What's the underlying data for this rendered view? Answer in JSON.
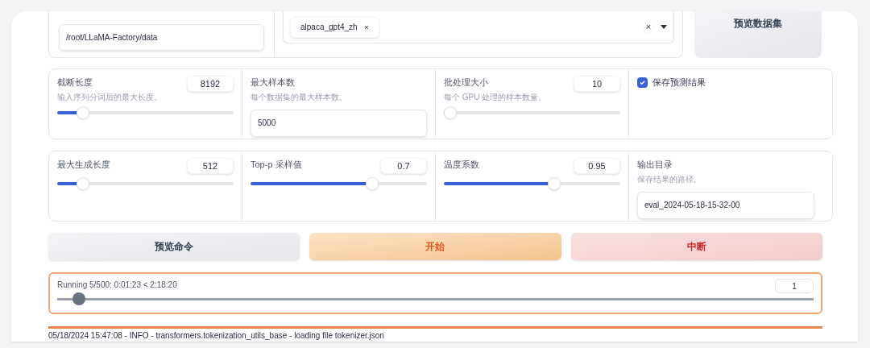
{
  "dataset_dir": {
    "value": "/root/LLaMA-Factory/data"
  },
  "dataset": {
    "tags": [
      "alpaca_gpt4_zh"
    ],
    "clear": "×"
  },
  "preview_dataset_button": "预览数据集",
  "params_row_1": [
    {
      "kind": "slider",
      "label": "截断长度",
      "info": "输入序列分词后的最大长度。",
      "value": "8192",
      "level": 0.12
    },
    {
      "kind": "textbox",
      "label": "最大样本数",
      "info": "每个数据集的最大样本数。",
      "value": "5000"
    },
    {
      "kind": "slider",
      "label": "批处理大小",
      "info": "每个 GPU 处理的样本数量。",
      "value": "10",
      "level": 0.01
    },
    {
      "kind": "checkbox",
      "label": "保存预测结果",
      "checked": true
    }
  ],
  "params_row_2": [
    {
      "kind": "slider",
      "label": "最大生成长度",
      "value": "512",
      "level": 0.12
    },
    {
      "kind": "slider",
      "label": "Top-p 采样值",
      "value": "0.7",
      "level": 0.66
    },
    {
      "kind": "slider",
      "label": "温度系数",
      "value": "0.95",
      "level": 0.6
    },
    {
      "kind": "textbox",
      "label": "输出目录",
      "info": "保存结果的路径。",
      "value": "eval_2024-05-18-15-32-00"
    }
  ],
  "actions": [
    {
      "kind": "secondary",
      "label": "预览命令"
    },
    {
      "kind": "primary",
      "label": "开始"
    },
    {
      "kind": "stop",
      "label": "中断"
    }
  ],
  "progress": {
    "label": "Running 5/500: 0:01:23 < 2:18:20",
    "value": "1",
    "level": 0.02
  },
  "log": "05/18/2024 15:47:08 - INFO - transformers.tokenization_utils_base - loading file tokenizer.json"
}
